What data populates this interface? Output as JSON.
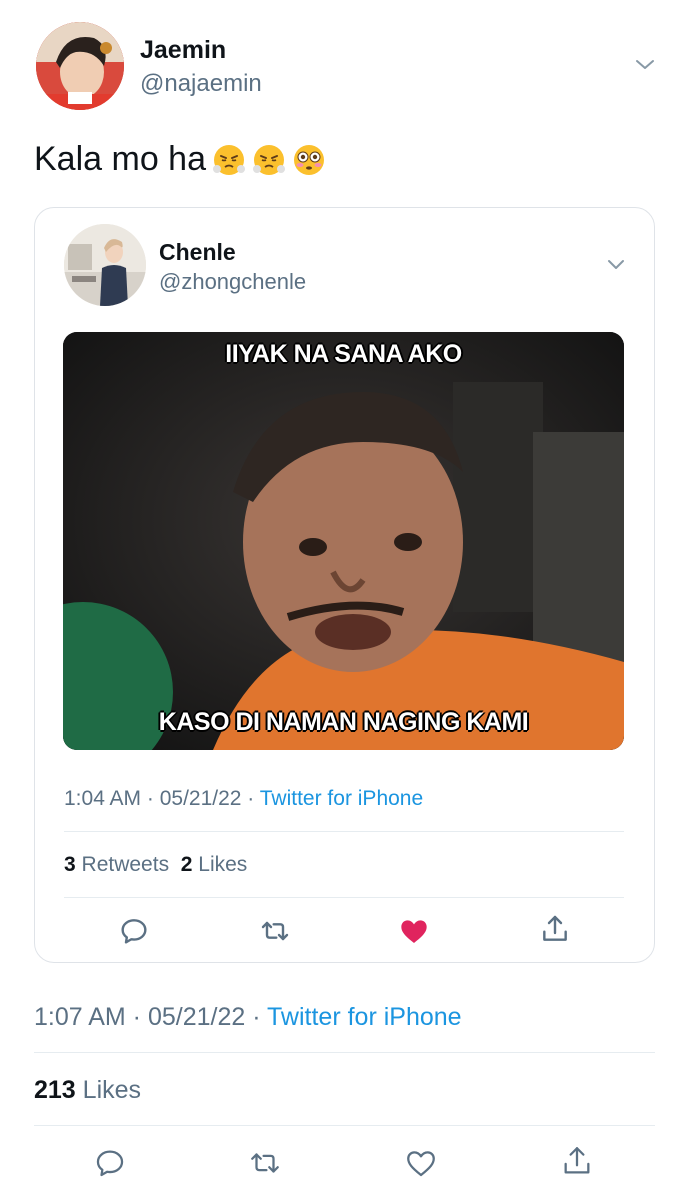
{
  "tweet": {
    "author": {
      "name": "Jaemin",
      "handle": "@najaemin"
    },
    "text": "Kala mo ha",
    "emojis": [
      "face-with-steam-icon",
      "face-with-steam-icon",
      "flushed-face-icon"
    ],
    "timestamp": "1:07 AM · 05/21/22 · ",
    "source": "Twitter for iPhone",
    "likes_count": "213",
    "likes_label": "Likes",
    "actions": [
      "reply-icon",
      "retweet-icon",
      "like-icon",
      "share-icon"
    ]
  },
  "quoted_tweet": {
    "author": {
      "name": "Chenle",
      "handle": "@zhongchenle"
    },
    "meme": {
      "top_caption": "IIYAK NA SANA AKO",
      "bottom_caption": "KASO DI NAMAN NAGING KAMI"
    },
    "timestamp": "1:04 AM · 05/21/22 · ",
    "source": "Twitter for iPhone",
    "retweets_count": "3",
    "retweets_label": "Retweets",
    "likes_count": "2",
    "likes_label": "Likes",
    "liked": true
  },
  "colors": {
    "link": "#1b95e0",
    "secondary_text": "#5b7083",
    "like_active": "#e0245e",
    "divider": "#e6ecf0"
  }
}
